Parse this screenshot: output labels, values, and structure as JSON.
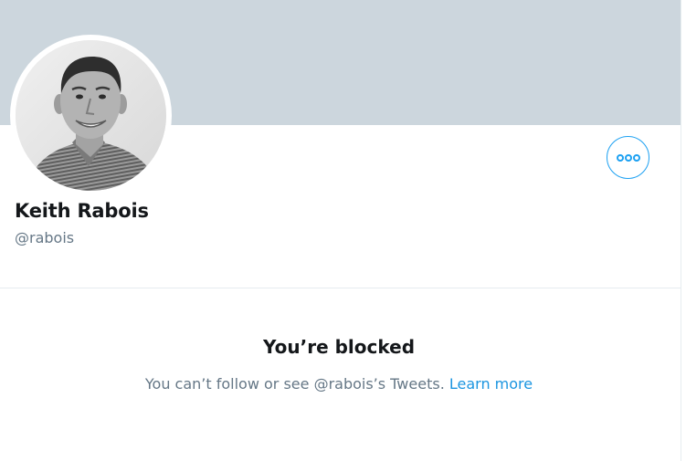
{
  "profile": {
    "display_name": "Keith Rabois",
    "handle": "@rabois",
    "avatar_alt": "Keith Rabois"
  },
  "actions": {
    "more_icon": "more-options-icon"
  },
  "blocked": {
    "title": "You’re blocked",
    "message": "You can’t follow or see @rabois’s Tweets.",
    "learn_more": "Learn more"
  },
  "colors": {
    "banner": "#ccd6dd",
    "accent": "#1da1f2",
    "link": "#1b95e0",
    "text_primary": "#14171a",
    "text_secondary": "#657786"
  }
}
